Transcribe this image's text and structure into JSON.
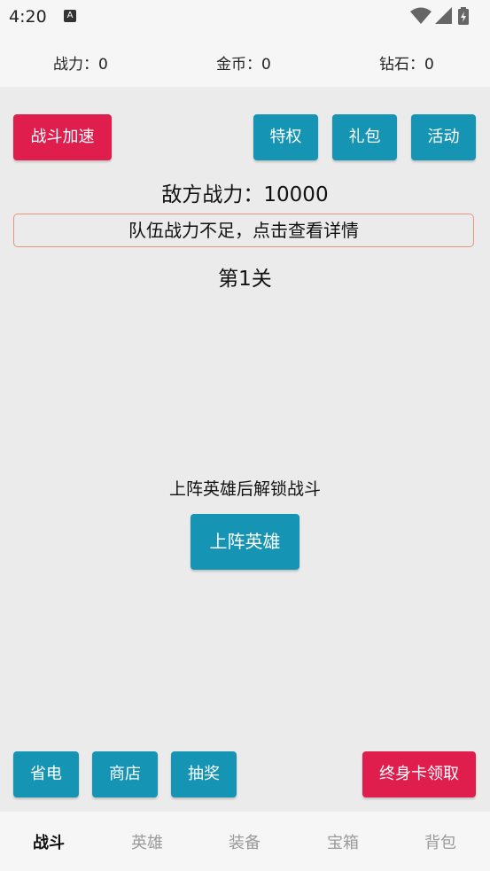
{
  "status_bar": {
    "time": "4:20",
    "notification_icon": "A"
  },
  "resources": {
    "power": "战力：0",
    "gold": "金币：0",
    "diamond": "钻石：0"
  },
  "top_buttons": {
    "speed_up": "战斗加速",
    "privilege": "特权",
    "gift_pack": "礼包",
    "event": "活动"
  },
  "battle": {
    "enemy_power": "敌方战力：10000",
    "notice": "队伍战力不足，点击查看详情",
    "level": "第1关",
    "unlock_hint": "上阵英雄后解锁战斗",
    "deploy_button": "上阵英雄"
  },
  "bottom_buttons": {
    "power_save": "省电",
    "shop": "商店",
    "lottery": "抽奖",
    "lifetime_card": "终身卡领取"
  },
  "nav": {
    "tabs": [
      "战斗",
      "英雄",
      "装备",
      "宝箱",
      "背包"
    ],
    "active": "战斗"
  },
  "colors": {
    "red": "#e01e4e",
    "blue": "#1594b3",
    "background": "#ebebeb"
  }
}
